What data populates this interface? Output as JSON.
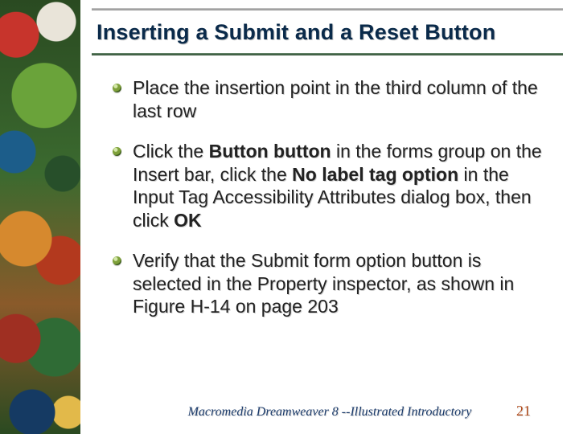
{
  "title": "Inserting a Submit and a Reset Button",
  "bullets": [
    {
      "segments": [
        {
          "t": "Place the insertion point in the third column of the last row",
          "b": false
        }
      ]
    },
    {
      "segments": [
        {
          "t": "Click the ",
          "b": false
        },
        {
          "t": "Button button",
          "b": true
        },
        {
          "t": " in the forms group on the Insert bar, click the ",
          "b": false
        },
        {
          "t": "No label tag option",
          "b": true
        },
        {
          "t": " in the Input Tag Accessibility Attributes dialog box, then click ",
          "b": false
        },
        {
          "t": "OK",
          "b": true
        }
      ]
    },
    {
      "segments": [
        {
          "t": "Verify that the Submit form option button is selected in the Property inspector, as shown in Figure H-14 on page 203",
          "b": false
        }
      ]
    }
  ],
  "footer": "Macromedia Dreamweaver 8 --Illustrated Introductory",
  "page": "21"
}
